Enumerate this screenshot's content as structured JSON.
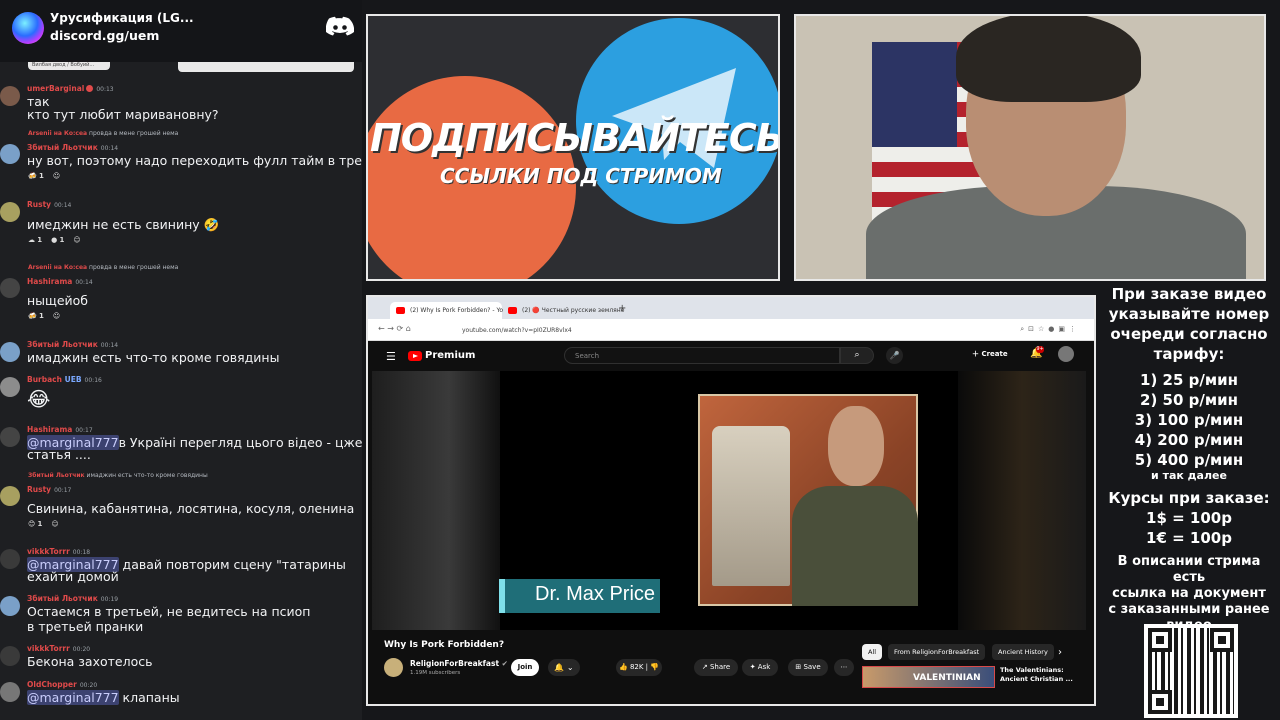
{
  "discord": {
    "server_name": "Урусификация (LG...",
    "invite": "discord.gg/uem",
    "strip_text": "Вилбая двод / Вобуий..."
  },
  "chat": [
    {
      "user": "umerBarginal",
      "time": "00:13",
      "color": "#e04a4a",
      "text": "так",
      "text2": "кто тут любит маривановну?",
      "avatar": "#7a5a4a"
    },
    {
      "reply_user": "Arsenii на Ко:сеа",
      "reply_text": "провда в мене грошей нема",
      "user": "Збитый Льотчик",
      "time": "00:14",
      "color": "#e04a4a",
      "text": "ну вот, поэтому надо переходить фулл тайм в третью",
      "reactions": [
        "1"
      ],
      "avatar": "#7aa0c8"
    },
    {
      "user": "Rusty",
      "time": "00:14",
      "color": "#e04a4a",
      "text": "имеджин не есть свинину 🤣",
      "reactions": [
        "1",
        "1"
      ],
      "avatar": "#a8a060"
    },
    {
      "reply_user": "Arsenii на Ко:сеа",
      "reply_text": "провда в мене грошей нема",
      "user": "Hashirama",
      "time": "00:14",
      "color": "#e04a4a",
      "text": "ныщейоб",
      "reactions": [
        "1"
      ],
      "avatar": "#444"
    },
    {
      "user": "Збитый Льотчик",
      "time": "00:14",
      "color": "#e04a4a",
      "text": "имаджин есть что-то кроме говядины",
      "avatar": "#7aa0c8"
    },
    {
      "user": "Burbach",
      "tag": "UEB",
      "time": "00:16",
      "color": "#e04a4a",
      "text": "😂",
      "avatar": "#8c8c8c"
    },
    {
      "user": "Hashirama",
      "time": "00:17",
      "color": "#e04a4a",
      "mention": "@marginal777",
      "text": "в Україні перегляд цього відео - цже",
      "text2": "статья ....",
      "avatar": "#444"
    },
    {
      "reply_user": "Збитый Льотчик",
      "reply_text": "имаджин есть что-то кроме говядины",
      "user": "Rusty",
      "time": "00:17",
      "color": "#e04a4a",
      "text": "Свинина, кабанятина, лосятина, косуля, оленина",
      "reactions": [
        "1"
      ],
      "avatar": "#a8a060"
    },
    {
      "user": "vikkkTorrr",
      "time": "00:18",
      "color": "#e04a4a",
      "mention": "@marginal777",
      "text": " давай повторим сцену \"татарины",
      "text2": "ехайти домой",
      "avatar": "#3a3a3a"
    },
    {
      "user": "Збитый Льотчик",
      "time": "00:19",
      "color": "#e04a4a",
      "text": "Остаемся в третьей, не ведитесь на псиоп",
      "text2": "в третьей пранки",
      "avatar": "#7aa0c8"
    },
    {
      "user": "vikkkTorrr",
      "time": "00:20",
      "color": "#e04a4a",
      "text": "Бекона захотелось",
      "avatar": "#3a3a3a"
    },
    {
      "user": "OldChopper",
      "time": "00:20",
      "color": "#e04a4a",
      "mention": "@marginal777",
      "text": " клапаны",
      "avatar": "#777"
    }
  ],
  "banner": {
    "headline": "ПОДПИСЫВАЙТЕСЬ",
    "subline": "ССЫЛКИ ПОД СТРИМОМ",
    "colors": {
      "orange": "#e86a43",
      "blue": "#2c9fe0"
    }
  },
  "browser": {
    "tabs": [
      {
        "label": "(2) Why Is Pork Forbidden? - Yo",
        "active": true
      },
      {
        "label": "(2) 🔴 Честный русские земляне",
        "active": false
      }
    ],
    "url": "youtube.com/watch?v=pI0ZUR8vlx4",
    "youtube": {
      "logo_label": "Premium",
      "search_placeholder": "Search",
      "create_label": "Create",
      "notif_count": "9+",
      "video_lower_third": "Dr. Max Price",
      "video_title": "Why Is Pork Forbidden?",
      "channel": "ReligionForBreakfast",
      "subscribers": "1.19M subscribers",
      "join": "Join",
      "likes": "82K",
      "share": "Share",
      "ask": "Ask",
      "save": "Save",
      "chips": [
        "All",
        "From ReligionForBreakfast",
        "Ancient History"
      ],
      "rec_thumb_text": "VALENTINIAN",
      "rec_title_1": "The Valentinians:",
      "rec_title_2": "Ancient Christian ..."
    }
  },
  "info": {
    "intro": [
      "При заказе видео",
      "указывайте номер",
      "очереди согласно",
      "тарифу:"
    ],
    "tariffs": [
      "1) 25 р/мин",
      "2) 50 р/мин",
      "3) 100 р/мин",
      "4) 200 р/мин",
      "5) 400 р/мин"
    ],
    "etc": "и так далее",
    "courses_title": "Курсы при заказе:",
    "rates": [
      "1$ = 100р",
      "1€ = 100р"
    ],
    "note": [
      "В описании стрима есть",
      "ссылка на документ",
      "с заказанными ранее",
      "видео"
    ]
  }
}
